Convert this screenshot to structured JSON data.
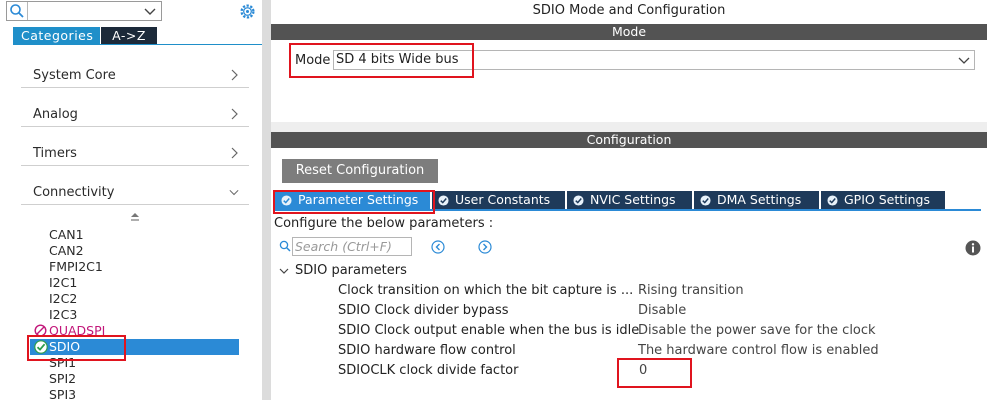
{
  "left_panel": {
    "tabs": {
      "categories": "Categories",
      "az": "A->Z"
    },
    "categories": [
      {
        "label": "System Core"
      },
      {
        "label": "Analog"
      },
      {
        "label": "Timers"
      },
      {
        "label": "Connectivity"
      }
    ],
    "peripherals": [
      "CAN1",
      "CAN2",
      "FMPI2C1",
      "I2C1",
      "I2C2",
      "I2C3",
      "QUADSPI",
      "SDIO",
      "SPI1",
      "SPI2",
      "SPI3"
    ]
  },
  "window_title": "SDIO Mode and Configuration",
  "mode_section": {
    "title": "Mode",
    "label": "Mode",
    "value": "SD 4 bits Wide bus"
  },
  "config_section": {
    "title": "Configuration",
    "reset_button": "Reset Configuration",
    "tabs": [
      "Parameter Settings",
      "User Constants",
      "NVIC Settings",
      "DMA Settings",
      "GPIO Settings"
    ],
    "active_tab": "Parameter Settings",
    "instruction": "Configure the below parameters :",
    "search_placeholder": "Search (Ctrl+F)",
    "group_title": "SDIO parameters",
    "params": [
      {
        "name": "Clock transition on which the bit capture is ...",
        "value": "Rising transition"
      },
      {
        "name": "SDIO Clock divider bypass",
        "value": "Disable"
      },
      {
        "name": "SDIO Clock output enable when the bus is idle",
        "value": "Disable the power save for the clock"
      },
      {
        "name": "SDIO hardware flow control",
        "value": "The hardware control flow is enabled"
      },
      {
        "name": "SDIOCLK clock divide factor",
        "value": "0"
      }
    ]
  },
  "colors": {
    "accent": "#2b8ad6",
    "section_bar": "#535353",
    "highlight": "#e0141e",
    "tab_dark": "#1e3a5a",
    "quadspi": "#c2177a"
  }
}
